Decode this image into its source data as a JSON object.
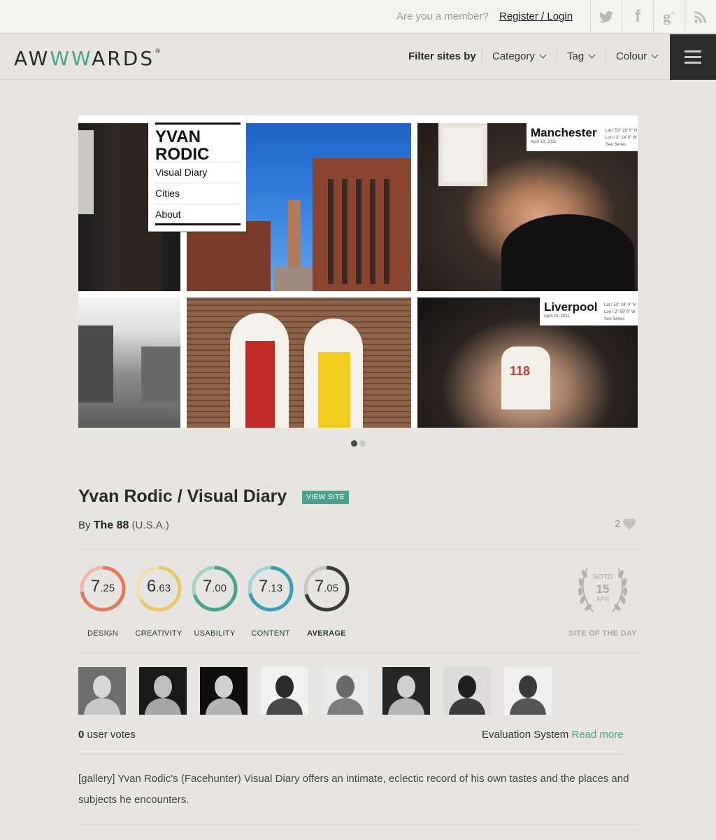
{
  "topbar": {
    "question": "Are you a member?",
    "register_login": "Register / Login",
    "social": [
      "twitter-icon",
      "facebook-icon",
      "google-plus-icon",
      "rss-icon"
    ]
  },
  "nav": {
    "logo": "AWWWARDS",
    "logo_mark": "®",
    "filter_label": "Filter sites by",
    "dropdowns": [
      "Category",
      "Tag",
      "Colour"
    ]
  },
  "gallery": {
    "menu_title": "YVAN RODIC",
    "menu_items": [
      "Visual Diary",
      "Cities",
      "About"
    ],
    "city_1": "Manchester",
    "city_1_date": "April 13, 2011",
    "city_2": "Liverpool",
    "city_2_date": "April 10, 2011",
    "coords_1": [
      "Lat / 53° 28' 0\" N",
      "Lon / 2° 14' 0\" W"
    ],
    "coords_2": [
      "Lat / 53° 24' 0\" N",
      "Lon / 2° 59' 0\" W"
    ],
    "see_series": "See Series",
    "shirt_text": "118",
    "slides": 2,
    "active_slide": 1
  },
  "site": {
    "title": "Yvan Rodic / Visual Diary",
    "view_site": "VIEW SITE",
    "by": "By",
    "author": "The 88",
    "country": "(U.S.A.)",
    "likes": "2"
  },
  "scores": [
    {
      "label": "DESIGN",
      "int": "7",
      "dec": ".25",
      "value": 7.25,
      "color": "#e07a5a",
      "track": "#eeb9a8"
    },
    {
      "label": "CREATIVITY",
      "int": "6",
      "dec": ".63",
      "value": 6.63,
      "color": "#e8c86a",
      "track": "#f2e0a8"
    },
    {
      "label": "USABILITY",
      "int": "7",
      "dec": ".00",
      "value": 7.0,
      "color": "#4aa38b",
      "track": "#a6d3c6"
    },
    {
      "label": "CONTENT",
      "int": "7",
      "dec": ".13",
      "value": 7.13,
      "color": "#3aa0b2",
      "track": "#a2d2da"
    },
    {
      "label": "AVERAGE",
      "int": "7",
      "dec": ".05",
      "value": 7.05,
      "color": "#3a3a3a",
      "track": "#c8c7c3"
    }
  ],
  "sotd": {
    "badge_top": "SOTD",
    "day": "15",
    "month": "APR",
    "label": "SITE OF THE DAY"
  },
  "jury_count": 8,
  "votes": {
    "count": "0",
    "label": "user votes"
  },
  "evaluation": {
    "label": "Evaluation System",
    "link": "Read more"
  },
  "description": "[gallery] Yvan Rodic's (Facehunter) Visual Diary offers an intimate, eclectic record of his own tastes and the places and subjects he encounters."
}
